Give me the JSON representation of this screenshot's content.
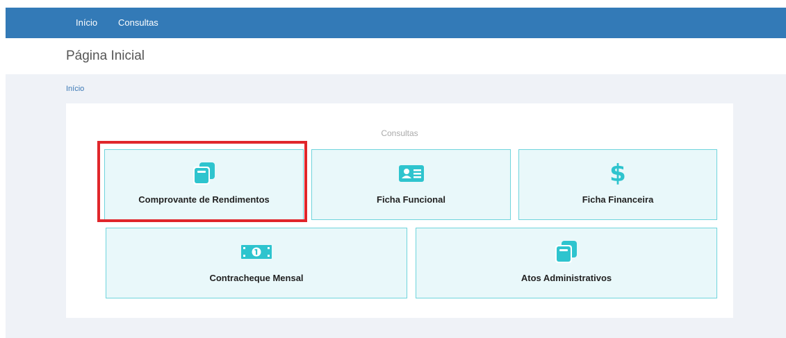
{
  "nav": {
    "items": [
      {
        "label": "Início"
      },
      {
        "label": "Consultas"
      }
    ]
  },
  "page": {
    "title": "Página Inicial"
  },
  "breadcrumb": {
    "label": "Início"
  },
  "consultas": {
    "title": "Consultas",
    "tiles": [
      {
        "label": "Comprovante de Rendimentos",
        "icon": "copy-icon"
      },
      {
        "label": "Ficha Funcional",
        "icon": "id-card-icon"
      },
      {
        "label": "Ficha Financeira",
        "icon": "dollar-icon"
      },
      {
        "label": "Contracheque Mensal",
        "icon": "money-bill-icon"
      },
      {
        "label": "Atos Administrativos",
        "icon": "copy-icon"
      }
    ]
  },
  "colors": {
    "topbar": "#337ab7",
    "tile_bg": "#e9f8fa",
    "tile_border": "#6fd4dc",
    "icon": "#2ec4ce",
    "highlight": "#e0262b"
  }
}
